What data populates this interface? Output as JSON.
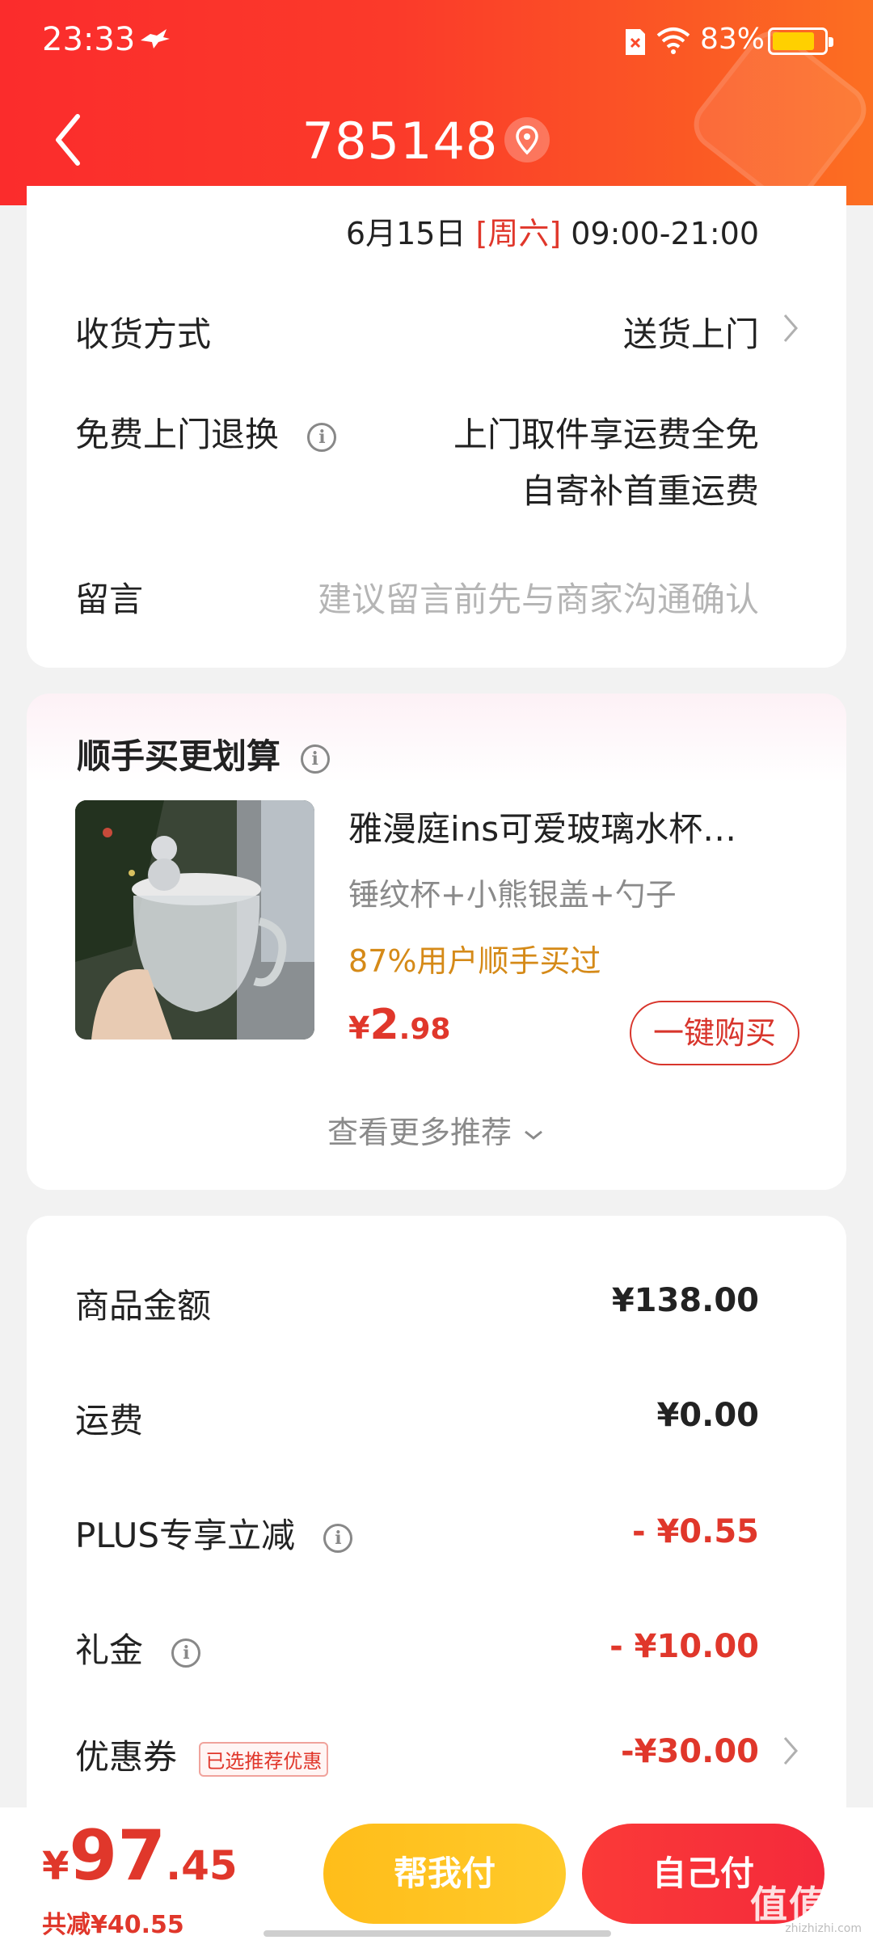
{
  "status_bar": {
    "time": "23:33",
    "battery_text": "83%",
    "battery_level": 0.83,
    "icons": [
      "bird-icon",
      "sim-icon",
      "wifi-icon",
      "battery-icon"
    ]
  },
  "header": {
    "title": "785148",
    "back_icon": "chevron-left-icon",
    "location_icon": "location-pin-icon",
    "bg_color": "#fb3a2a"
  },
  "delivery": {
    "date": "6月15日",
    "weekday": "[周六]",
    "time_range": "09:00-21:00"
  },
  "shipping_method": {
    "label": "收货方式",
    "value": "送货上门"
  },
  "free_return": {
    "label": "免费上门退换",
    "value_line1": "上门取件享运费全免",
    "value_line2": "自寄补首重运费"
  },
  "message": {
    "label": "留言",
    "placeholder": "建议留言前先与商家沟通确认"
  },
  "recommend": {
    "title": "顺手买更划算",
    "product": {
      "name": "雅漫庭ins可爱玻璃水杯…",
      "spec": "锤纹杯+小熊银盖+勺子",
      "hint": "87%用户顺手买过",
      "price_currency": "¥",
      "price_int": "2",
      "price_dec": ".98",
      "buy_label": "一键购买"
    },
    "more_label": "查看更多推荐"
  },
  "summary": {
    "goods": {
      "label": "商品金额",
      "value": "¥138.00"
    },
    "shipping": {
      "label": "运费",
      "value": "¥0.00"
    },
    "plus": {
      "label": "PLUS专享立减",
      "value": "- ¥0.55"
    },
    "gift": {
      "label": "礼金",
      "value": "- ¥10.00"
    },
    "coupon": {
      "label": "优惠券",
      "tag": "已选推荐优惠",
      "value": "-¥30.00"
    }
  },
  "bottom": {
    "total_currency": "¥",
    "total_int": "97",
    "total_dec": ".45",
    "saved": "共减¥40.55",
    "help_pay": "帮我付",
    "self_pay": "自己付",
    "watermark": "值值值",
    "watermark_sub": "zhizhizhi.com"
  },
  "colors": {
    "accent_red": "#e0372b",
    "hint_orange": "#d58a18",
    "help_btn": "#ffbd1a",
    "self_btn": "#f42a3b"
  }
}
